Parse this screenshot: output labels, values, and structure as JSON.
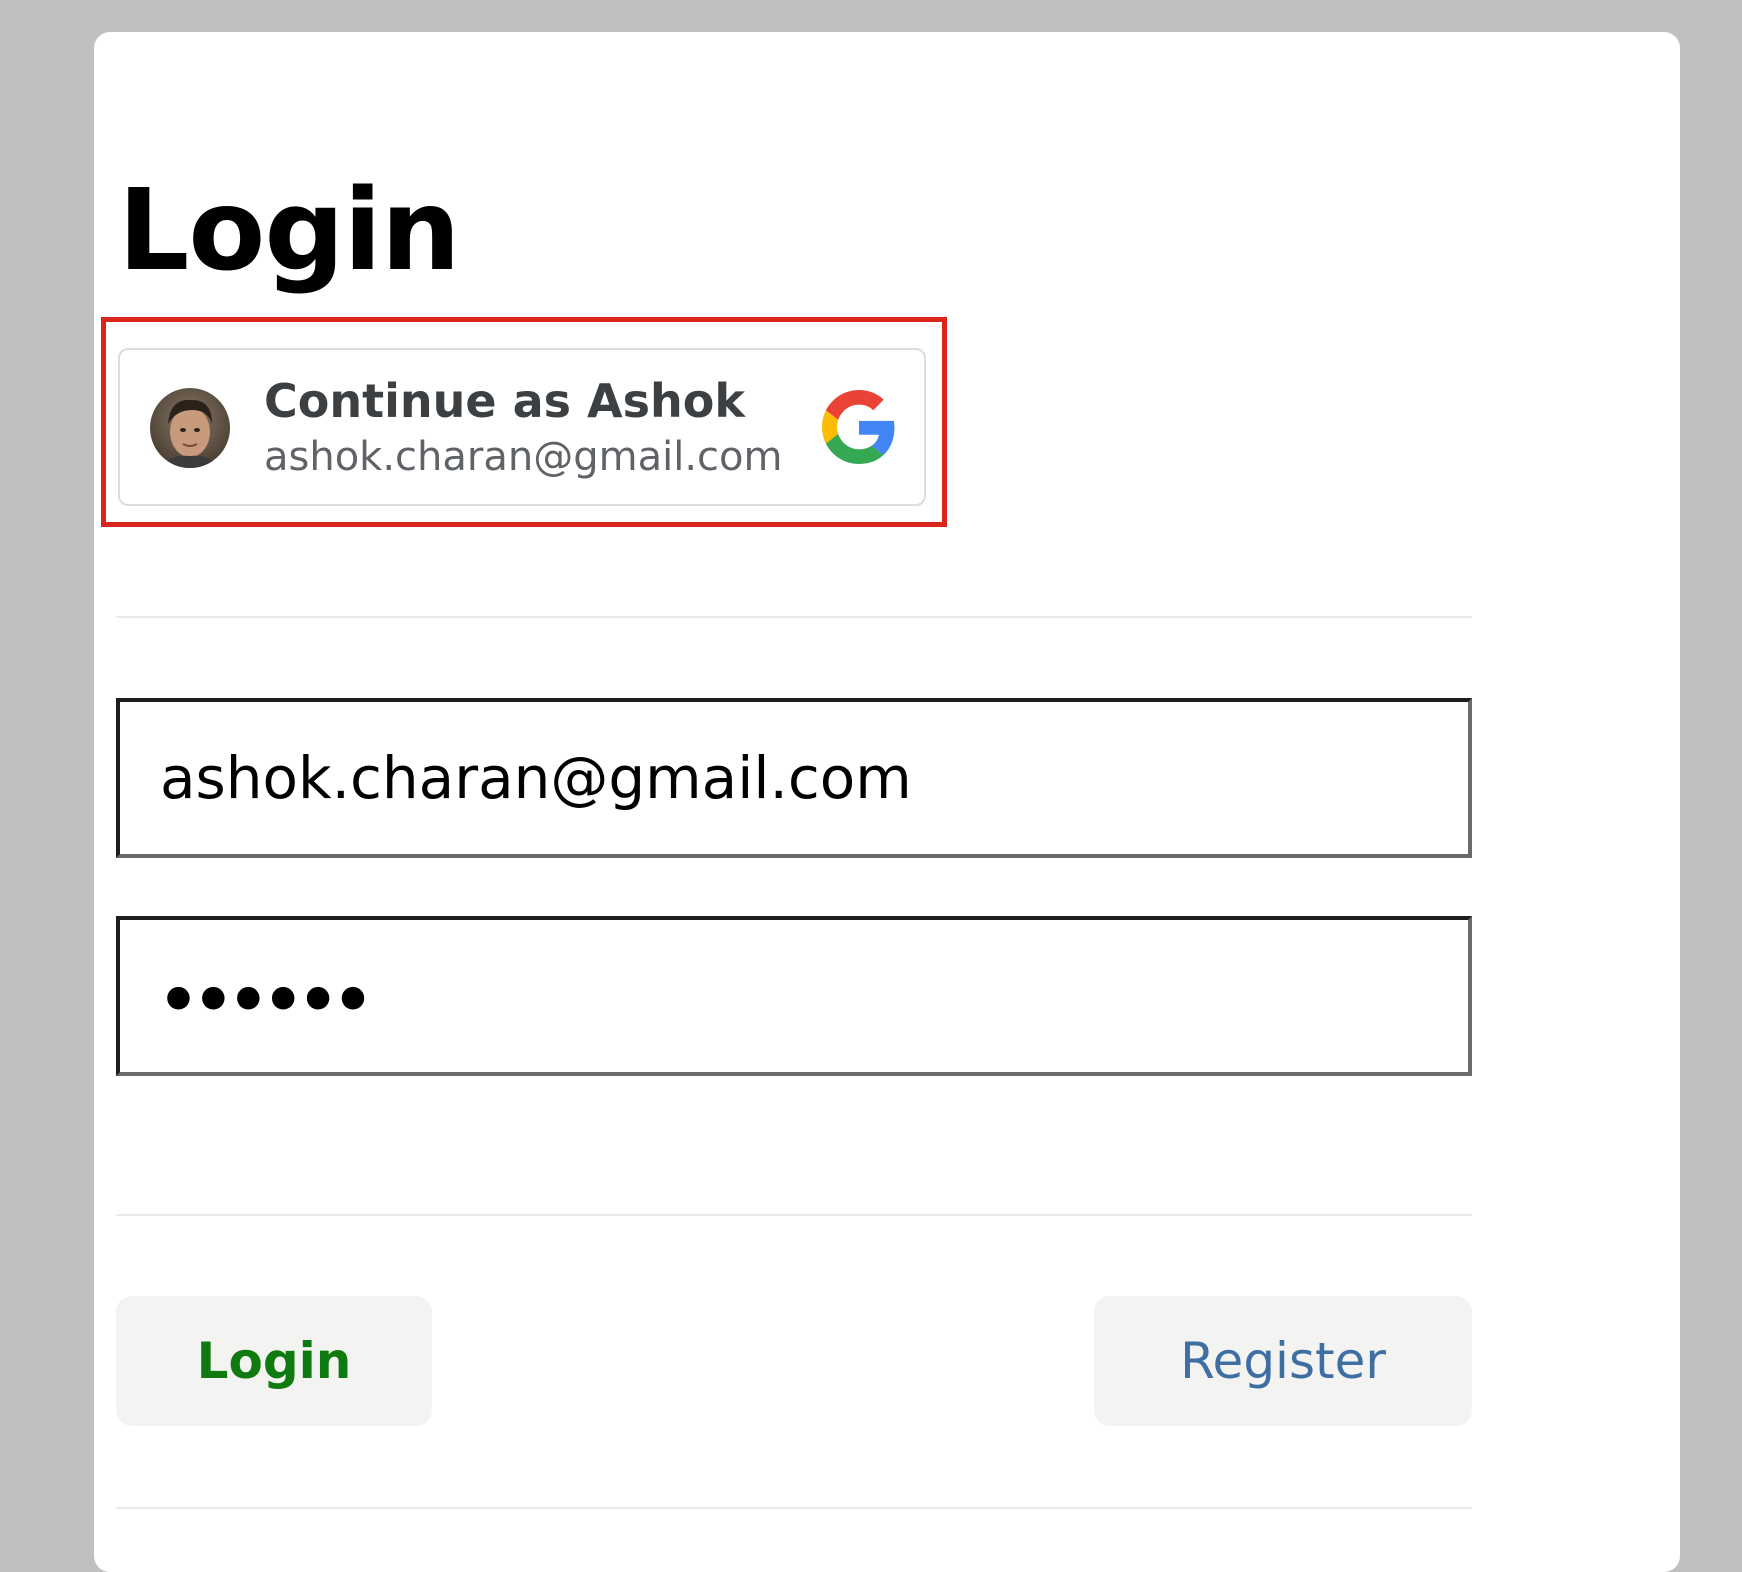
{
  "page": {
    "title": "Login"
  },
  "google_signin": {
    "name_line": "Continue as Ashok",
    "email": "ashok.charan@gmail.com",
    "avatar_icon": "user-avatar-photo",
    "provider_icon": "google-logo-icon"
  },
  "form": {
    "email_value": "ashok.charan@gmail.com",
    "password_mask": "••••••"
  },
  "buttons": {
    "login_label": "Login",
    "register_label": "Register"
  },
  "colors": {
    "highlight": "#d9261c",
    "login_text": "#0f7a0f",
    "register_text": "#3e6fa3",
    "background": "#c0c0c0"
  }
}
